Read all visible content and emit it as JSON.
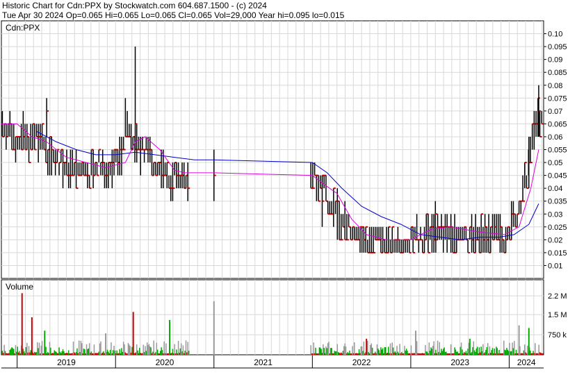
{
  "header": {
    "line1": "Historic Chart for Cdn:PPX by Stockwatch.com 604.687.1500 - (c) 2024",
    "line2": "Tue Apr 30 2024   Op=0.065  Hi=0.065  Lo=0.065  Cl=0.065  Vol=29,000   Year hi=0.095  lo=0.015"
  },
  "colors": {
    "price_bar": "#000000",
    "close_tick": "#cc0000",
    "ma_short": "#dd00dd",
    "ma_long": "#0000cc",
    "vol_up": "#00aa00",
    "vol_down": "#cc0000",
    "vol_flat": "#999999",
    "grid": "#d8d8d8",
    "frame": "#000000"
  },
  "chart_data": [
    {
      "type": "ohlc",
      "title": "Cdn:PPX",
      "ylim": [
        0.005,
        0.105
      ],
      "y_ticks": [
        0.1,
        0.095,
        0.09,
        0.085,
        0.08,
        0.075,
        0.07,
        0.065,
        0.06,
        0.055,
        0.05,
        0.045,
        0.04,
        0.035,
        0.03,
        0.025,
        0.02,
        0.015,
        0.01
      ],
      "y_tick_labels": [
        "0.10",
        "0.095",
        "0.09",
        "0.085",
        "0.08",
        "0.075",
        "0.07",
        "0.065",
        "0.06",
        "0.055",
        "0.05",
        "0.045",
        "0.04",
        "0.035",
        "0.03",
        "0.025",
        "0.02",
        "0.015",
        "0.01"
      ],
      "xlim": [
        2018.84,
        2024.35
      ],
      "year_labels": [
        {
          "year": "2019",
          "start": 2019.0,
          "end": 2020.0
        },
        {
          "year": "2020",
          "start": 2020.0,
          "end": 2021.0
        },
        {
          "year": "2021",
          "start": 2021.0,
          "end": 2022.0
        },
        {
          "year": "2022",
          "start": 2022.0,
          "end": 2023.0
        },
        {
          "year": "2023",
          "start": 2023.0,
          "end": 2024.0
        },
        {
          "year": "2024",
          "start": 2024.0,
          "end": 2024.35
        }
      ],
      "grid": true,
      "price_path": [
        [
          2018.84,
          0.065
        ],
        [
          2019.05,
          0.06
        ],
        [
          2019.15,
          0.058
        ],
        [
          2019.25,
          0.06
        ],
        [
          2019.35,
          0.052
        ],
        [
          2019.5,
          0.048
        ],
        [
          2019.65,
          0.046
        ],
        [
          2019.8,
          0.048
        ],
        [
          2019.95,
          0.048
        ],
        [
          2020.05,
          0.052
        ],
        [
          2020.1,
          0.065
        ],
        [
          2020.15,
          0.06
        ],
        [
          2020.25,
          0.055
        ],
        [
          2020.35,
          0.052
        ],
        [
          2020.45,
          0.048
        ],
        [
          2020.55,
          0.044
        ],
        [
          2020.65,
          0.045
        ],
        [
          2020.7,
          0.045
        ],
        [
          2022.0,
          0.045
        ],
        [
          2022.12,
          0.04
        ],
        [
          2022.22,
          0.032
        ],
        [
          2022.35,
          0.025
        ],
        [
          2022.5,
          0.02
        ],
        [
          2022.7,
          0.019
        ],
        [
          2022.9,
          0.018
        ],
        [
          2023.05,
          0.02
        ],
        [
          2023.2,
          0.023
        ],
        [
          2023.4,
          0.022
        ],
        [
          2023.6,
          0.021
        ],
        [
          2023.8,
          0.022
        ],
        [
          2023.95,
          0.021
        ],
        [
          2024.1,
          0.03
        ],
        [
          2024.2,
          0.05
        ],
        [
          2024.28,
          0.07
        ],
        [
          2024.33,
          0.065
        ]
      ],
      "spikes": [
        {
          "x": 2019.3,
          "high": 0.075,
          "low": 0.06
        },
        {
          "x": 2020.2,
          "high": 0.095,
          "low": 0.055
        },
        {
          "x": 2021.0,
          "high": 0.055,
          "low": 0.035
        },
        {
          "x": 2022.1,
          "high": 0.045,
          "low": 0.025
        },
        {
          "x": 2023.25,
          "high": 0.035,
          "low": 0.02
        },
        {
          "x": 2024.2,
          "high": 0.06,
          "low": 0.04
        },
        {
          "x": 2024.3,
          "high": 0.08,
          "low": 0.06
        }
      ],
      "ma_short": [
        [
          2018.84,
          0.065
        ],
        [
          2019.0,
          0.065
        ],
        [
          2019.15,
          0.06
        ],
        [
          2019.3,
          0.058
        ],
        [
          2019.5,
          0.052
        ],
        [
          2019.7,
          0.05
        ],
        [
          2019.9,
          0.048
        ],
        [
          2020.1,
          0.05
        ],
        [
          2020.2,
          0.058
        ],
        [
          2020.3,
          0.06
        ],
        [
          2020.45,
          0.055
        ],
        [
          2020.6,
          0.047
        ],
        [
          2020.7,
          0.046
        ],
        [
          2021.0,
          0.046
        ],
        [
          2022.0,
          0.045
        ],
        [
          2022.1,
          0.042
        ],
        [
          2022.25,
          0.038
        ],
        [
          2022.4,
          0.028
        ],
        [
          2022.55,
          0.022
        ],
        [
          2022.75,
          0.02
        ],
        [
          2023.0,
          0.02
        ],
        [
          2023.2,
          0.024
        ],
        [
          2023.4,
          0.025
        ],
        [
          2023.7,
          0.023
        ],
        [
          2023.95,
          0.022
        ],
        [
          2024.1,
          0.025
        ],
        [
          2024.22,
          0.04
        ],
        [
          2024.3,
          0.055
        ]
      ],
      "ma_long": [
        [
          2019.2,
          0.062
        ],
        [
          2019.4,
          0.058
        ],
        [
          2019.6,
          0.055
        ],
        [
          2019.8,
          0.053
        ],
        [
          2020.0,
          0.053
        ],
        [
          2020.2,
          0.054
        ],
        [
          2020.4,
          0.053
        ],
        [
          2020.6,
          0.052
        ],
        [
          2020.8,
          0.051
        ],
        [
          2021.0,
          0.051
        ],
        [
          2022.0,
          0.05
        ],
        [
          2022.15,
          0.046
        ],
        [
          2022.3,
          0.04
        ],
        [
          2022.5,
          0.033
        ],
        [
          2022.7,
          0.029
        ],
        [
          2022.9,
          0.026
        ],
        [
          2023.1,
          0.022
        ],
        [
          2023.3,
          0.021
        ],
        [
          2023.5,
          0.02
        ],
        [
          2023.7,
          0.021
        ],
        [
          2023.9,
          0.021
        ],
        [
          2024.05,
          0.022
        ],
        [
          2024.2,
          0.026
        ],
        [
          2024.3,
          0.034
        ]
      ]
    },
    {
      "type": "bar",
      "title": "Volume",
      "ylim": [
        0,
        2.8
      ],
      "y_ticks": [
        2.2,
        1.5,
        0.75
      ],
      "y_tick_labels": [
        "2.2 M",
        "1.5 M",
        "750 k"
      ],
      "unit": "million shares",
      "spikes": [
        {
          "x": 2019.05,
          "value": 2.3,
          "dir": "down"
        },
        {
          "x": 2019.15,
          "value": 1.4,
          "dir": "down"
        },
        {
          "x": 2019.28,
          "value": 0.9,
          "dir": "up"
        },
        {
          "x": 2019.9,
          "value": 0.8,
          "dir": "flat"
        },
        {
          "x": 2020.18,
          "value": 1.6,
          "dir": "down"
        },
        {
          "x": 2020.55,
          "value": 1.3,
          "dir": "up"
        },
        {
          "x": 2021.0,
          "value": 2.0,
          "dir": "flat"
        },
        {
          "x": 2022.55,
          "value": 0.6,
          "dir": "down"
        },
        {
          "x": 2023.05,
          "value": 0.9,
          "dir": "flat"
        },
        {
          "x": 2023.6,
          "value": 0.6,
          "dir": "up"
        },
        {
          "x": 2024.1,
          "value": 1.1,
          "dir": "flat"
        },
        {
          "x": 2024.2,
          "value": 1.0,
          "dir": "up"
        }
      ]
    }
  ]
}
